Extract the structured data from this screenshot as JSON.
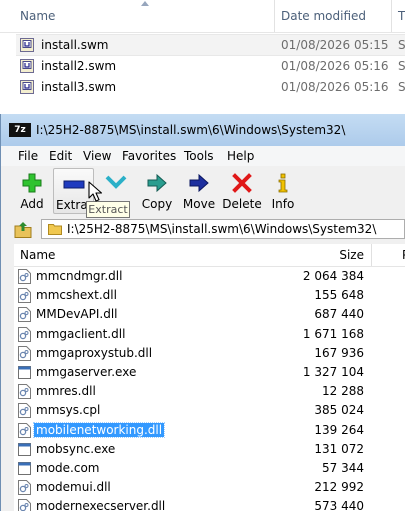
{
  "explorer": {
    "columns": {
      "name": "Name",
      "date": "Date modified",
      "type": "T"
    },
    "files": [
      {
        "name": "install.swm",
        "date": "01/08/2026 05:15",
        "type": "S",
        "selected": true
      },
      {
        "name": "install2.swm",
        "date": "01/08/2026 05:16",
        "type": "S"
      },
      {
        "name": "install3.swm",
        "date": "01/08/2026 05:16",
        "type": "S"
      }
    ]
  },
  "sevenzip": {
    "logo": "7z",
    "title": "I:\\25H2-8875\\MS\\install.swm\\6\\Windows\\System32\\",
    "menu": [
      "File",
      "Edit",
      "View",
      "Favorites",
      "Tools",
      "Help"
    ],
    "toolbar": {
      "add": "Add",
      "extract": "Extract",
      "test": "Test",
      "copy": "Copy",
      "move": "Move",
      "delete": "Delete",
      "info": "Info"
    },
    "tooltip": "Extract",
    "address": "I:\\25H2-8875\\MS\\install.swm\\6\\Windows\\System32\\",
    "list": {
      "columns": {
        "name": "Name",
        "size": "Size",
        "next": "P"
      },
      "rows": [
        {
          "name": "mmcndmgr.dll",
          "size": "2 064 384",
          "icon": "dll"
        },
        {
          "name": "mmcshext.dll",
          "size": "155 648",
          "icon": "dll"
        },
        {
          "name": "MMDevAPI.dll",
          "size": "687 440",
          "icon": "dll"
        },
        {
          "name": "mmgaclient.dll",
          "size": "1 671 168",
          "icon": "dll"
        },
        {
          "name": "mmgaproxystub.dll",
          "size": "167 936",
          "icon": "dll"
        },
        {
          "name": "mmgaserver.exe",
          "size": "1 327 104",
          "icon": "exe"
        },
        {
          "name": "mmres.dll",
          "size": "12 288",
          "icon": "dll"
        },
        {
          "name": "mmsys.cpl",
          "size": "385 024",
          "icon": "dll"
        },
        {
          "name": "mobilenetworking.dll",
          "size": "139 264",
          "icon": "dll",
          "selected": true
        },
        {
          "name": "mobsync.exe",
          "size": "131 072",
          "icon": "exe"
        },
        {
          "name": "mode.com",
          "size": "57 344",
          "icon": "exe"
        },
        {
          "name": "modemui.dll",
          "size": "212 992",
          "icon": "dll"
        },
        {
          "name": "modernexecserver.dll",
          "size": "573 440",
          "icon": "dll"
        }
      ]
    }
  },
  "colors": {
    "selection": "#3399ff",
    "titlebar": "#b9d3ee",
    "header_text": "#4c607a"
  }
}
